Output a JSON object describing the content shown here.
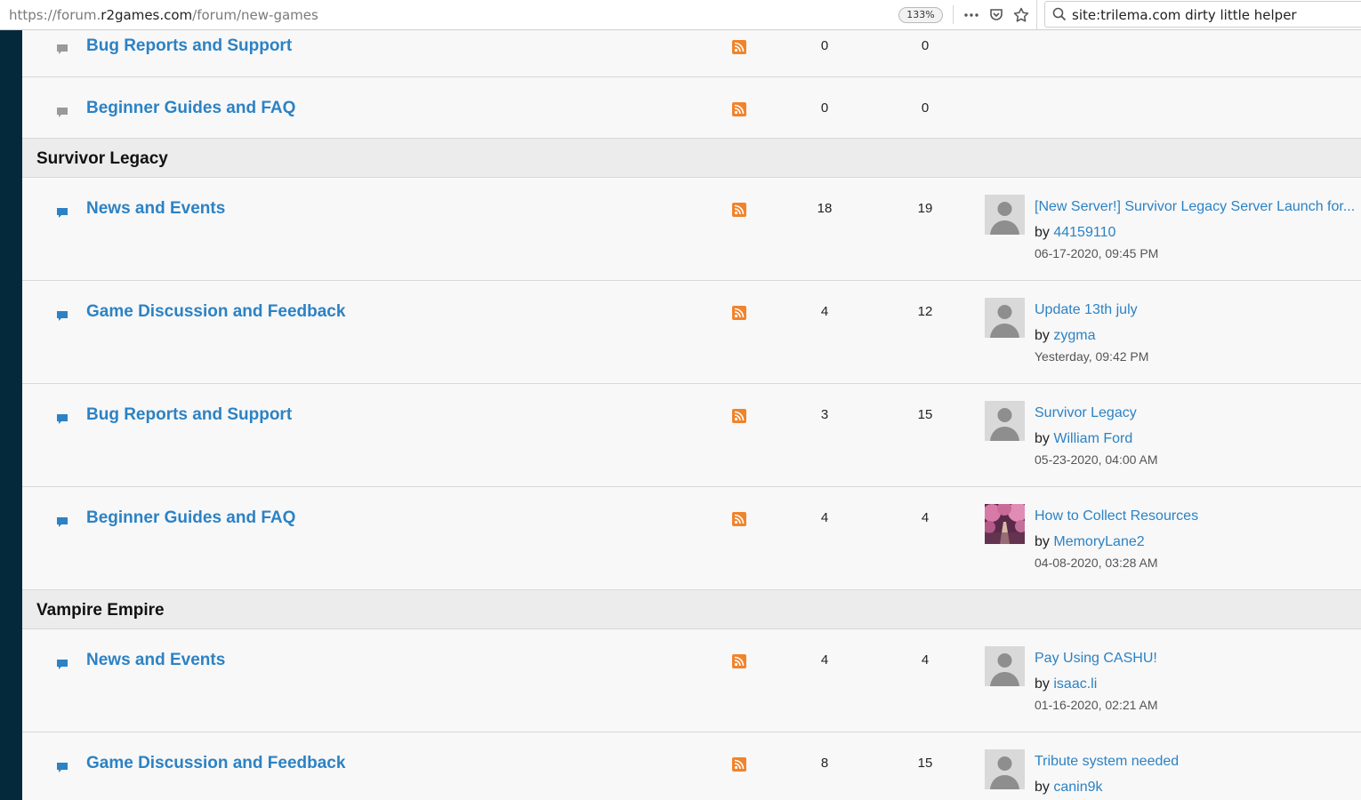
{
  "browser": {
    "url_prefix": "https://forum.",
    "url_host": "r2games.com",
    "url_path": "/forum/new-games",
    "zoom": "133%",
    "search_text": "site:trilema.com dirty little helper",
    "page_actions_icon": "ellipsis-icon",
    "pocket_icon": "pocket-icon",
    "bookmark_icon": "star-icon",
    "search_icon": "magnifier-icon"
  },
  "colors": {
    "link": "#2c82c4",
    "rss": "#f0842c",
    "sidebar": "#04293a"
  },
  "rows_top": [
    {
      "title": "Bug Reports and Support",
      "threads": "0",
      "posts": "0"
    },
    {
      "title": "Beginner Guides and FAQ",
      "threads": "0",
      "posts": "0"
    }
  ],
  "categories": [
    {
      "name": "Survivor Legacy",
      "forums": [
        {
          "title": "News and Events",
          "threads": "18",
          "posts": "19",
          "last_title": "[New Server!] Survivor Legacy Server Launch for...",
          "by": "by",
          "user": "44159110",
          "date": "06-17-2020, 09:45 PM",
          "avatar": "default"
        },
        {
          "title": "Game Discussion and Feedback",
          "threads": "4",
          "posts": "12",
          "last_title": "Update 13th july",
          "by": "by",
          "user": "zygma",
          "date": "Yesterday, 09:42 PM",
          "avatar": "default"
        },
        {
          "title": "Bug Reports and Support",
          "threads": "3",
          "posts": "15",
          "last_title": "Survivor Legacy",
          "by": "by",
          "user": "William Ford",
          "date": "05-23-2020, 04:00 AM",
          "avatar": "default"
        },
        {
          "title": "Beginner Guides and FAQ",
          "threads": "4",
          "posts": "4",
          "last_title": "How to Collect Resources",
          "by": "by",
          "user": "MemoryLane2",
          "date": "04-08-2020, 03:28 AM",
          "avatar": "photo"
        }
      ]
    },
    {
      "name": "Vampire Empire",
      "forums": [
        {
          "title": "News and Events",
          "threads": "4",
          "posts": "4",
          "last_title": "Pay Using CASHU!",
          "by": "by",
          "user": "isaac.li",
          "date": "01-16-2020, 02:21 AM",
          "avatar": "default"
        },
        {
          "title": "Game Discussion and Feedback",
          "threads": "8",
          "posts": "15",
          "last_title": "Tribute system needed",
          "by": "by",
          "user": "canin9k",
          "date": "",
          "avatar": "default"
        }
      ]
    }
  ]
}
